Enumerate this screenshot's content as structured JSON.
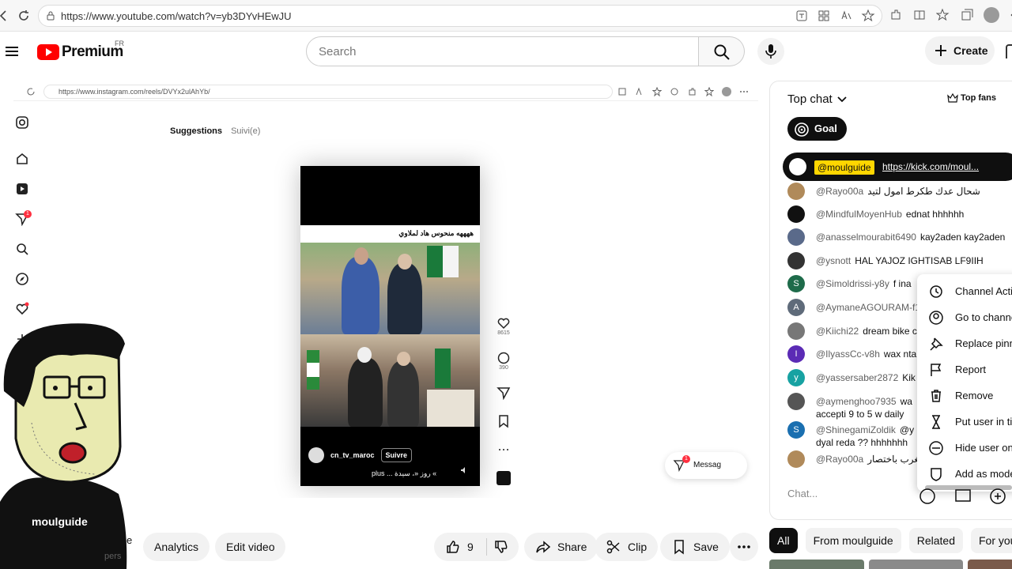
{
  "browser": {
    "url": "https://www.youtube.com/watch?v=yb3DYvHEwJU"
  },
  "header": {
    "logo_text": "Premium",
    "country_code": "FR",
    "search_placeholder": "Search",
    "create_label": "Create"
  },
  "video": {
    "inner_url": "https://www.instagram.com/reels/DVYx2ulAhYb/",
    "ig_tabs": [
      "Suggestions",
      "Suivi(e)"
    ],
    "notif_count": "1",
    "reel": {
      "caption": "ههههه منحوس هاد لملاوي",
      "account": "cn_tv_maroc",
      "follow_label": "Suivre",
      "subtitle": "plus ... روز «، سيدة «",
      "likes": "8615",
      "comments": "390"
    },
    "messages_label": "Messag",
    "messages_count": "1"
  },
  "cartoon": {
    "shirt_text": "moulguide",
    "caption_fragment": "e",
    "caption_fragment2": "pers"
  },
  "actions": {
    "analytics": "Analytics",
    "edit_video": "Edit video",
    "likes": "9",
    "share": "Share",
    "clip": "Clip",
    "save": "Save"
  },
  "chat": {
    "header": "Top chat",
    "top_fans": "Top fans",
    "goal": "Goal",
    "pinned": {
      "author": "@moulguide",
      "link": "https://kick.com/moul..."
    },
    "messages": [
      {
        "author": "@Rayo00a",
        "text": "شحال عدك طكرط امول لتيد",
        "color": "#b08a5a",
        "initial": ""
      },
      {
        "author": "@MindfulMoyenHub",
        "text": "ednat hhhhhh",
        "color": "#111111",
        "initial": ""
      },
      {
        "author": "@anasselmourabit6490",
        "text": "kay2aden kay2aden",
        "color": "#5a6a8a",
        "initial": ""
      },
      {
        "author": "@ysnott",
        "text": "HAL YAJOZ IGHTISAB LF9IIH",
        "color": "#333333",
        "initial": ""
      },
      {
        "author": "@Simoldrissi-y8y",
        "text": "f ina",
        "color": "#1e6b4a",
        "initial": "S"
      },
      {
        "author": "@AymaneAGOURAM-f1",
        "text": "",
        "color": "#5f6b7a",
        "initial": "A"
      },
      {
        "author": "@Kiichi22",
        "text": "dream bike c",
        "color": "#777777",
        "initial": ""
      },
      {
        "author": "@IlyassCc-v8h",
        "text": "wax nta",
        "color": "#5b2bb5",
        "initial": "I"
      },
      {
        "author": "@yassersaber2872",
        "text": "Kik",
        "color": "#17a2a2",
        "initial": "y"
      },
      {
        "author": "@aymenghoo7935",
        "text": "wa",
        "text2": "accepti 9 to 5 w daily",
        "color": "#555555",
        "initial": ""
      },
      {
        "author": "@ShinegamiZoldik",
        "text": "@y",
        "text2": "dyal reda ?? hhhhhhh",
        "color": "#1a6fb0",
        "initial": "S"
      },
      {
        "author": "@Rayo00a",
        "text": "مغرب باختصار",
        "color": "#b08a5a",
        "initial": ""
      }
    ],
    "input_placeholder": "Chat...",
    "menu": [
      "Channel Acti",
      "Go to channe",
      "Replace pinn",
      "Report",
      "Remove",
      "Put user in ti",
      "Hide user on",
      "Add as mode"
    ],
    "chips": [
      "All",
      "From moulguide",
      "Related",
      "For you"
    ]
  }
}
